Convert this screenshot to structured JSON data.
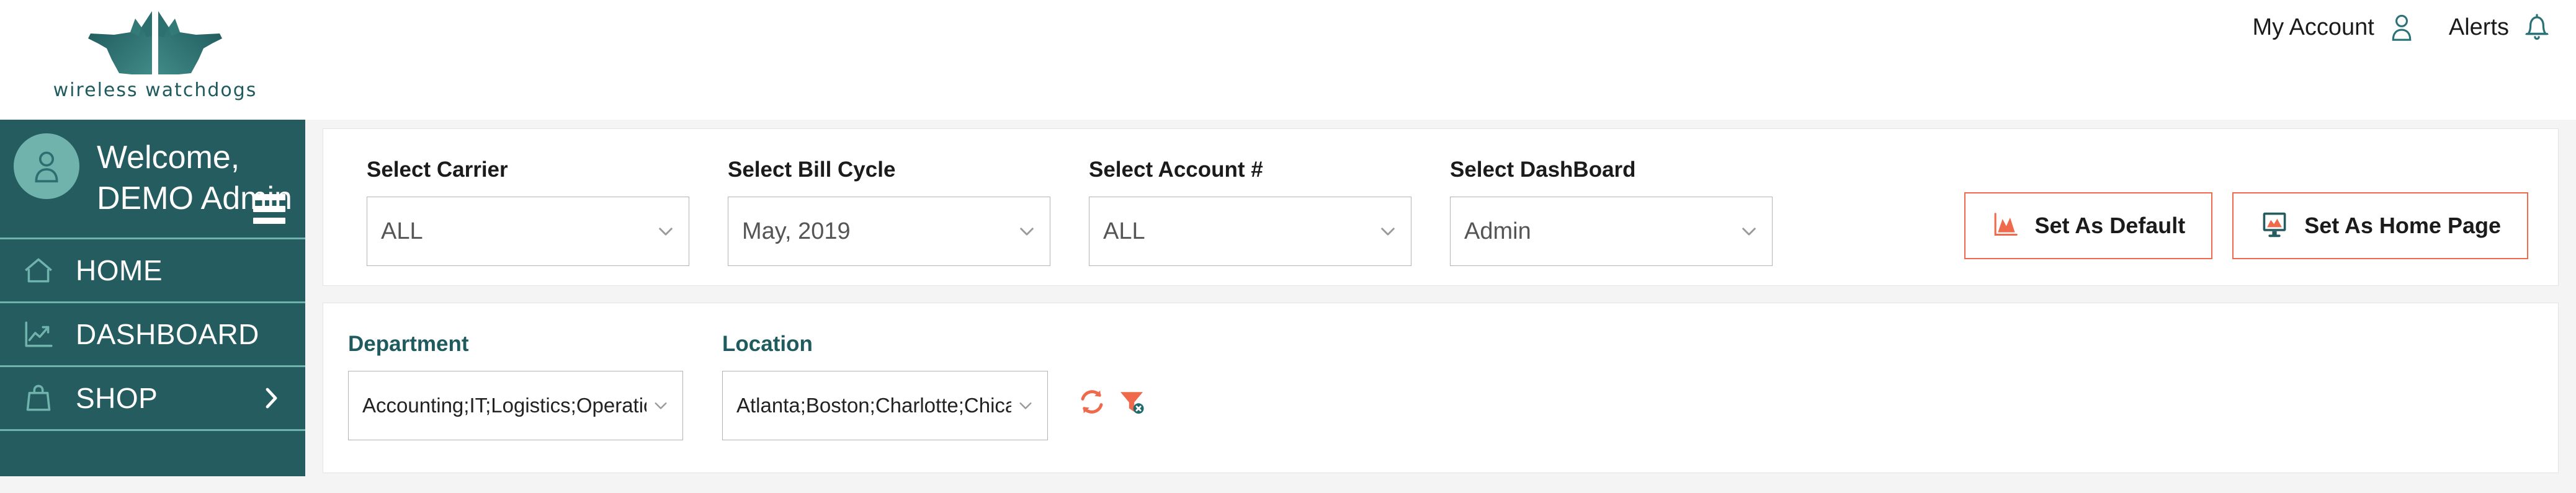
{
  "brand": {
    "wordmark": "wireless watchdogs",
    "logo_icon": "twin-dog-head-logo",
    "teal": "#1f5b5e",
    "sidebar_teal": "#255c60",
    "accent_coral": "#ef6a4c",
    "avatar_teal": "#6fb3ac"
  },
  "header": {
    "my_account_label": "My Account",
    "my_account_icon": "user-icon",
    "alerts_label": "Alerts",
    "alerts_icon": "bell-icon"
  },
  "sidebar": {
    "welcome_greeting": "Welcome,",
    "welcome_user": "DEMO Admin",
    "avatar_icon": "user-avatar-icon",
    "menu_toggle_icon": "hamburger-icon",
    "items": [
      {
        "label": "HOME",
        "icon": "home-icon",
        "has_chevron": false
      },
      {
        "label": "DASHBOARD",
        "icon": "chart-line-icon",
        "has_chevron": false
      },
      {
        "label": "SHOP",
        "icon": "shopping-bag-icon",
        "has_chevron": true
      }
    ]
  },
  "filters": {
    "carrier": {
      "label": "Select Carrier",
      "value": "ALL"
    },
    "bill_cycle": {
      "label": "Select Bill Cycle",
      "value": "May, 2019"
    },
    "account": {
      "label": "Select Account #",
      "value": "ALL"
    },
    "dashboard": {
      "label": "Select DashBoard",
      "value": "Admin"
    }
  },
  "buttons": {
    "set_as_default": {
      "label": "Set As Default",
      "icon": "chart-area-icon"
    },
    "set_as_home_page": {
      "label": "Set As Home Page",
      "icon": "monitor-chart-icon"
    }
  },
  "subfilters": {
    "department": {
      "label": "Department",
      "value": "Accounting;IT;Logistics;Operations"
    },
    "location": {
      "label": "Location",
      "value": "Atlanta;Boston;Charlotte;Chicago;D"
    },
    "refresh_icon": "refresh-icon",
    "clear_filter_icon": "filter-clear-icon"
  }
}
